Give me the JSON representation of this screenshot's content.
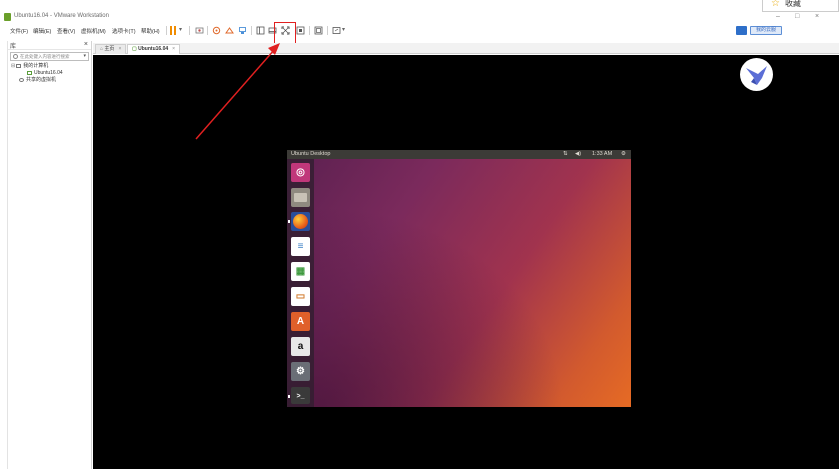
{
  "window": {
    "title": "Ubuntu16.04 - VMware Workstation",
    "controls": {
      "minimize": "–",
      "maximize": "□",
      "close": "×"
    }
  },
  "bookmark": {
    "icon": "star-icon",
    "label": "收藏"
  },
  "menu": {
    "items": [
      "文件(F)",
      "编辑(E)",
      "查看(V)",
      "虚拟机(M)",
      "选项卡(T)",
      "帮助(H)"
    ],
    "right_button": "我的云服"
  },
  "toolbar": {
    "icons": [
      "pause-icon",
      "dropdown-icon",
      "send-keys-icon",
      "snapshot-icon",
      "revert-snapshot-icon",
      "manage-snapshots-icon",
      "library-view-icon",
      "thumbnail-view-icon",
      "fullscreen-icon",
      "unity-icon",
      "console-view-icon",
      "stretch-icon",
      "stretch-dropdown-icon"
    ],
    "highlighted_icon": "fullscreen-icon",
    "accent_color": "#f08c00",
    "highlight_color": "#e02020"
  },
  "library": {
    "header": "库",
    "close": "×",
    "search_placeholder": "在此处键入内容进行搜索",
    "tree": [
      {
        "label": "我的计算机",
        "level": 0,
        "icon": "computer-icon"
      },
      {
        "label": "Ubuntu16.04",
        "level": 1,
        "icon": "vm-icon"
      },
      {
        "label": "共享的虚拟机",
        "level": 0,
        "icon": "shared-vm-icon"
      }
    ]
  },
  "tabs": [
    {
      "label": "主页",
      "active": false
    },
    {
      "label": "Ubuntu16.04",
      "active": true
    }
  ],
  "ubuntu": {
    "panel_title": "Ubuntu Desktop",
    "indicators": {
      "network": "⇅",
      "sound": "◀)",
      "clock": "1:33 AM",
      "power": "⚙"
    },
    "launcher": [
      {
        "name": "ubuntu-dash-icon",
        "glyph": "◎",
        "color": "#c0377a"
      },
      {
        "name": "files-icon",
        "glyph": "",
        "color": "#8f8a80"
      },
      {
        "name": "firefox-icon",
        "glyph": "",
        "color": "#e8601c"
      },
      {
        "name": "writer-icon",
        "glyph": "≡",
        "color": "#3b7fc4"
      },
      {
        "name": "calc-icon",
        "glyph": "▦",
        "color": "#3f9a3f"
      },
      {
        "name": "impress-icon",
        "glyph": "▭",
        "color": "#d2792a"
      },
      {
        "name": "software-center-icon",
        "glyph": "A",
        "color": "#e0602a"
      },
      {
        "name": "amazon-icon",
        "glyph": "a",
        "color": "#e8e8e8"
      },
      {
        "name": "settings-icon",
        "glyph": "⚙",
        "color": "#6a6e76"
      },
      {
        "name": "terminal-icon",
        "glyph": ">_",
        "color": "#3a3a3a"
      }
    ],
    "colors": {
      "panel": "#3c3b37",
      "accent": "#e95420"
    }
  },
  "overlay_logo": {
    "icon": "bird-logo-icon",
    "color": "#5b6ed6"
  }
}
